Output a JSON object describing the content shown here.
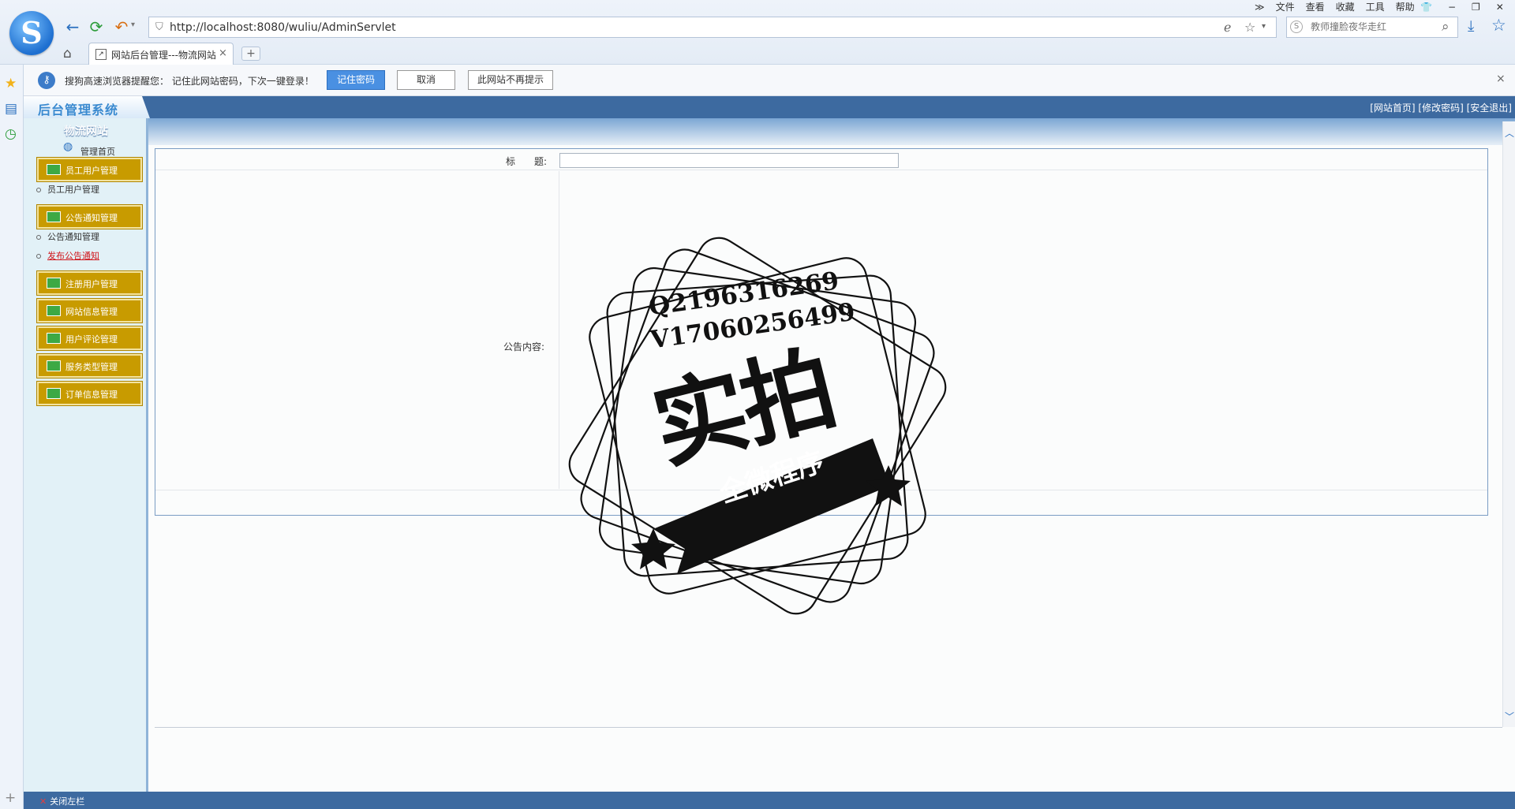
{
  "browser": {
    "url": "http://localhost:8080/wuliu/AdminServlet",
    "search_placeholder": "教师撞脸夜华走红",
    "menu": [
      "文件",
      "查看",
      "收藏",
      "工具",
      "帮助"
    ],
    "window_controls": [
      "≫",
      "−",
      "❐",
      "✕"
    ],
    "tab_title": "网站后台管理---物流网站",
    "tab_close": "×",
    "tab_new": "+",
    "nav_glyphs": {
      "back": "←",
      "refresh": "⟳",
      "undo": "↶"
    }
  },
  "password_bar": {
    "message": "搜狗高速浏览器提醒您：  记住此网站密码，下次一键登录！",
    "remember": "记住密码",
    "cancel": "取消",
    "never": "此网站不再提示",
    "close": "×"
  },
  "header": {
    "system_title": "后台管理系统",
    "links": [
      "[网站首页]",
      "[修改密码]",
      "[安全退出]"
    ]
  },
  "sidebar": {
    "site_name": "物流网站",
    "home": "管理首页",
    "groups": [
      {
        "label": "员工用户管理"
      },
      {
        "label": "公告通知管理"
      },
      {
        "label": "注册用户管理"
      },
      {
        "label": "网站信息管理"
      },
      {
        "label": "用户评论管理"
      },
      {
        "label": "服务类型管理"
      },
      {
        "label": "订单信息管理"
      }
    ],
    "sub_items": [
      "员工用户管理",
      "公告通知管理",
      "发布公告通知"
    ]
  },
  "form": {
    "title_label": "标　　题:",
    "title_value": "",
    "content_label": "公告内容:"
  },
  "footer": {
    "close_left": "关闭左栏"
  },
  "watermark": {
    "line1": "Q2196316269",
    "line2": "V17060256499",
    "big": "实拍",
    "banner": "全微程序"
  },
  "colors": {
    "band": "#3d6aa0",
    "menu_gold": "#c89b00",
    "active_link": "#d0141a"
  }
}
